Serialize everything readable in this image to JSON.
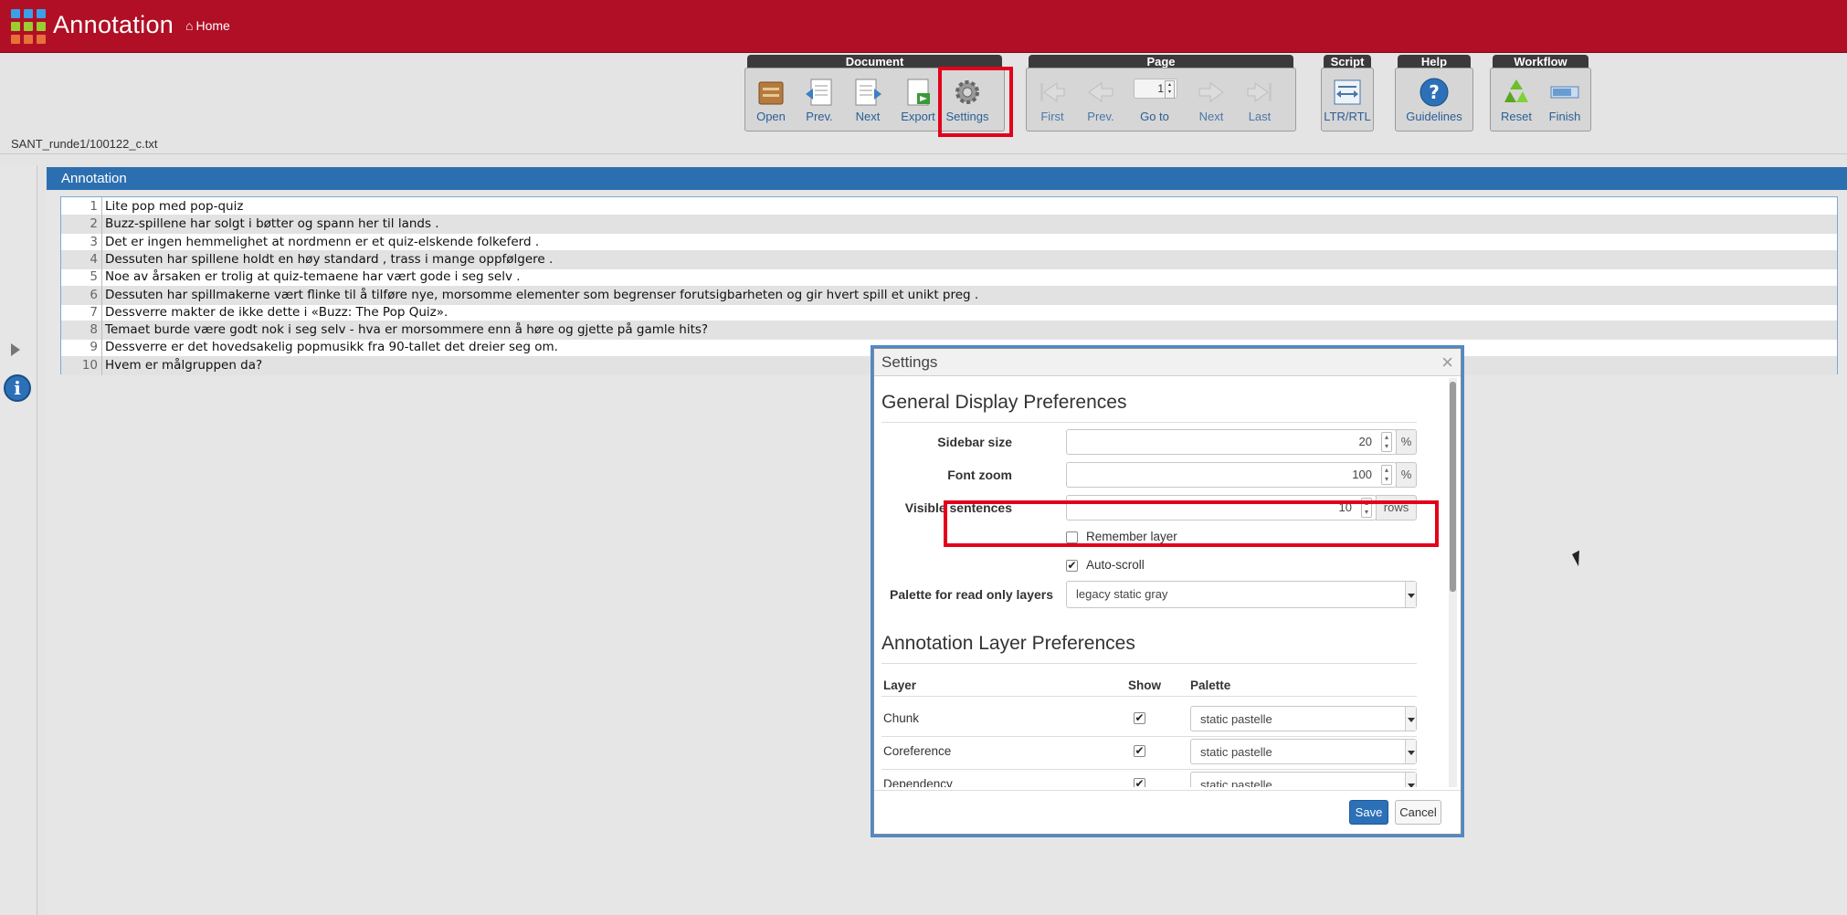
{
  "header": {
    "app_title": "Annotation",
    "home_label": "Home",
    "logo_colors": [
      "#3aa0e8",
      "#3aa0e8",
      "#3aa0e8",
      "#9acd32",
      "#9acd32",
      "#9acd32",
      "#e8703a",
      "#e8703a",
      "#e8703a"
    ]
  },
  "toolbar": {
    "document": {
      "title": "Document",
      "buttons": [
        {
          "label": "Open",
          "icon": "folder-icon"
        },
        {
          "label": "Prev.",
          "icon": "previous-document-icon"
        },
        {
          "label": "Next",
          "icon": "next-document-icon"
        },
        {
          "label": "Export",
          "icon": "export-icon"
        },
        {
          "label": "Settings",
          "icon": "gear-icon"
        }
      ]
    },
    "page": {
      "title": "Page",
      "page_number": "1",
      "buttons": [
        {
          "label": "First",
          "icon": "first-page-icon"
        },
        {
          "label": "Prev.",
          "icon": "previous-page-icon"
        },
        {
          "label": "Go to",
          "icon": "goto-icon"
        },
        {
          "label": "Next",
          "icon": "next-page-icon"
        },
        {
          "label": "Last",
          "icon": "last-page-icon"
        }
      ]
    },
    "script": {
      "title": "Script",
      "buttons": [
        {
          "label": "LTR/RTL",
          "icon": "text-direction-icon"
        }
      ]
    },
    "help": {
      "title": "Help",
      "buttons": [
        {
          "label": "Guidelines",
          "icon": "help-icon"
        }
      ]
    },
    "workflow": {
      "title": "Workflow",
      "buttons": [
        {
          "label": "Reset",
          "icon": "recycle-icon"
        },
        {
          "label": "Finish",
          "icon": "finish-icon"
        }
      ]
    }
  },
  "document_path": "SANT_runde1/100122_c.txt",
  "panel": {
    "title": "Annotation"
  },
  "sentences": [
    {
      "num": "1",
      "text": "Lite pop med pop-quiz"
    },
    {
      "num": "2",
      "text": "Buzz-spillene har solgt i bøtter og spann her til lands ."
    },
    {
      "num": "3",
      "text": "Det er ingen hemmelighet at nordmenn er et quiz-elskende folkeferd ."
    },
    {
      "num": "4",
      "text": "Dessuten har spillene holdt en høy standard , trass i mange oppfølgere ."
    },
    {
      "num": "5",
      "text": "Noe av årsaken er trolig at quiz-temaene har vært gode i seg selv ."
    },
    {
      "num": "6",
      "text": "Dessuten har spillmakerne vært flinke til å tilføre nye, morsomme elementer som begrenser forutsigbarheten og gir hvert spill et unikt preg ."
    },
    {
      "num": "7",
      "text": "Dessverre makter de ikke dette i «Buzz: The Pop Quiz»."
    },
    {
      "num": "8",
      "text": "Temaet burde være godt nok i seg selv - hva er morsommere enn å høre og gjette på gamle hits?"
    },
    {
      "num": "9",
      "text": "Dessverre er det hovedsakelig popmusikk fra 90-tallet det dreier seg om."
    },
    {
      "num": "10",
      "text": "Hvem er målgruppen da?"
    }
  ],
  "settings": {
    "title": "Settings",
    "general_heading": "General Display Preferences",
    "sidebar_size": {
      "label": "Sidebar size",
      "value": "20",
      "unit": "%"
    },
    "font_zoom": {
      "label": "Font zoom",
      "value": "100",
      "unit": "%"
    },
    "visible_sentences": {
      "label": "Visible sentences",
      "value": "10",
      "unit": "rows"
    },
    "remember_layer": {
      "label": "Remember layer",
      "checked": false
    },
    "auto_scroll": {
      "label": "Auto-scroll",
      "checked": true
    },
    "palette_readonly": {
      "label": "Palette for read only layers",
      "value": "legacy static gray"
    },
    "layer_heading": "Annotation Layer Preferences",
    "columns": {
      "layer": "Layer",
      "show": "Show",
      "palette": "Palette"
    },
    "layers": [
      {
        "name": "Chunk",
        "palette": "static pastelle"
      },
      {
        "name": "Coreference",
        "palette": "static pastelle"
      },
      {
        "name": "Dependency",
        "palette": "static pastelle"
      }
    ],
    "save_label": "Save",
    "cancel_label": "Cancel"
  }
}
